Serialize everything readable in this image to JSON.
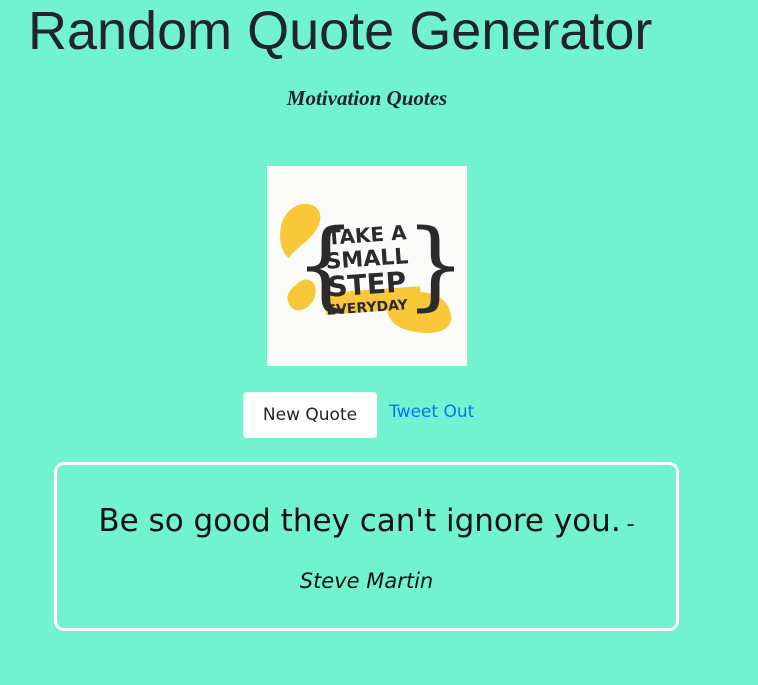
{
  "header": {
    "title": "Random Quote Generator",
    "subtitle": "Motivation Quotes"
  },
  "image": {
    "lines": [
      "TAKE A",
      "SMALL",
      "STEP",
      "EVERYDAY"
    ],
    "accent_color": "#f8c73a"
  },
  "actions": {
    "new_quote_label": "New Quote",
    "tweet_label": "Tweet Out"
  },
  "quote": {
    "text": "Be so good they can't ignore you.",
    "dash": "-",
    "author": "Steve Martin"
  },
  "colors": {
    "background": "#72f3cf",
    "link": "#0d6efd"
  }
}
